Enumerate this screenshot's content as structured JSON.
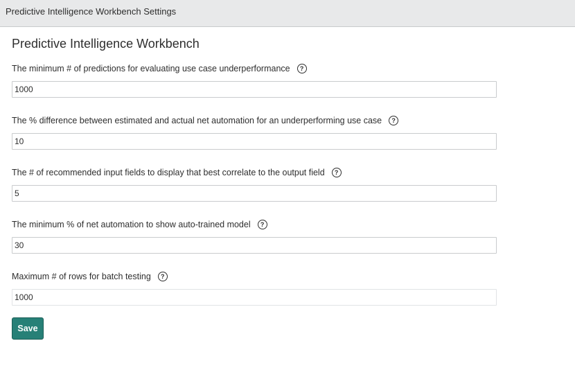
{
  "window": {
    "title": "Predictive Intelligence Workbench Settings"
  },
  "page": {
    "heading": "Predictive Intelligence Workbench"
  },
  "fields": [
    {
      "label": "The minimum # of predictions for evaluating use case underperformance",
      "value": "1000",
      "help_icon": "question-circle-icon"
    },
    {
      "label": "The % difference between estimated and actual net automation for an underperforming use case",
      "value": "10",
      "help_icon": "question-circle-icon"
    },
    {
      "label": "The # of recommended input fields to display that best correlate to the output field",
      "value": "5",
      "help_icon": "question-circle-icon"
    },
    {
      "label": "The minimum % of net automation to show auto-trained model",
      "value": "30",
      "help_icon": "question-circle-icon"
    },
    {
      "label": "Maximum # of rows for batch testing",
      "value": "1000",
      "help_icon": "question-circle-icon"
    }
  ],
  "help_glyph": "?",
  "actions": {
    "save_label": "Save"
  },
  "colors": {
    "titlebar_bg": "#e8e9ea",
    "primary_button": "#278077",
    "text": "#2e2e2e"
  }
}
